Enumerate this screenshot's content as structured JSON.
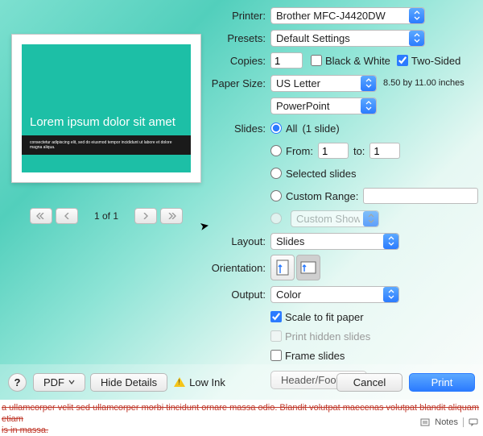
{
  "header": {
    "printer_label": "Printer:",
    "printer_value": "Brother MFC-J4420DW",
    "presets_label": "Presets:",
    "presets_value": "Default Settings",
    "copies_label": "Copies:",
    "copies_value": "1",
    "bw_label": "Black & White",
    "bw_checked": false,
    "twosided_label": "Two-Sided",
    "twosided_checked": true,
    "papersize_label": "Paper Size:",
    "papersize_value": "US Letter",
    "papersize_dim": "8.50 by 11.00 inches",
    "app_dropdown": "PowerPoint"
  },
  "slides": {
    "section_label": "Slides:",
    "all_label": "All",
    "all_count": "(1 slide)",
    "from_label": "From:",
    "from_value": "1",
    "to_label": "to:",
    "to_value": "1",
    "selected_label": "Selected slides",
    "custom_range_label": "Custom Range:",
    "custom_range_value": "",
    "custom_shows_label": "Custom Shows"
  },
  "layout": {
    "label": "Layout:",
    "value": "Slides"
  },
  "orientation": {
    "label": "Orientation:"
  },
  "output": {
    "label": "Output:",
    "value": "Color",
    "scale_label": "Scale to fit paper",
    "scale_checked": true,
    "hidden_label": "Print hidden slides",
    "hidden_checked": false,
    "frame_label": "Frame slides",
    "frame_checked": false,
    "header_footer_btn": "Header/Footer..."
  },
  "preview": {
    "slide_title": "Lorem ipsum dolor sit amet",
    "slide_sub": "consectetur adipiscing elit, sed do eiusmod tempor incididunt ut labore et dolore magna aliqua.",
    "page_indicator": "1 of 1"
  },
  "bottom": {
    "help": "?",
    "pdf_btn": "PDF",
    "hide_details_btn": "Hide Details",
    "low_ink": "Low Ink",
    "cancel_btn": "Cancel",
    "print_btn": "Print"
  },
  "doc": {
    "line1": "a ullamcorper velit sed ullamcorper morbi tincidunt ornare massa odio. Blandit volutpat maecenas volutpat blandit aliquam etiam",
    "line2": "is in massa.",
    "notes_label": "Notes"
  }
}
